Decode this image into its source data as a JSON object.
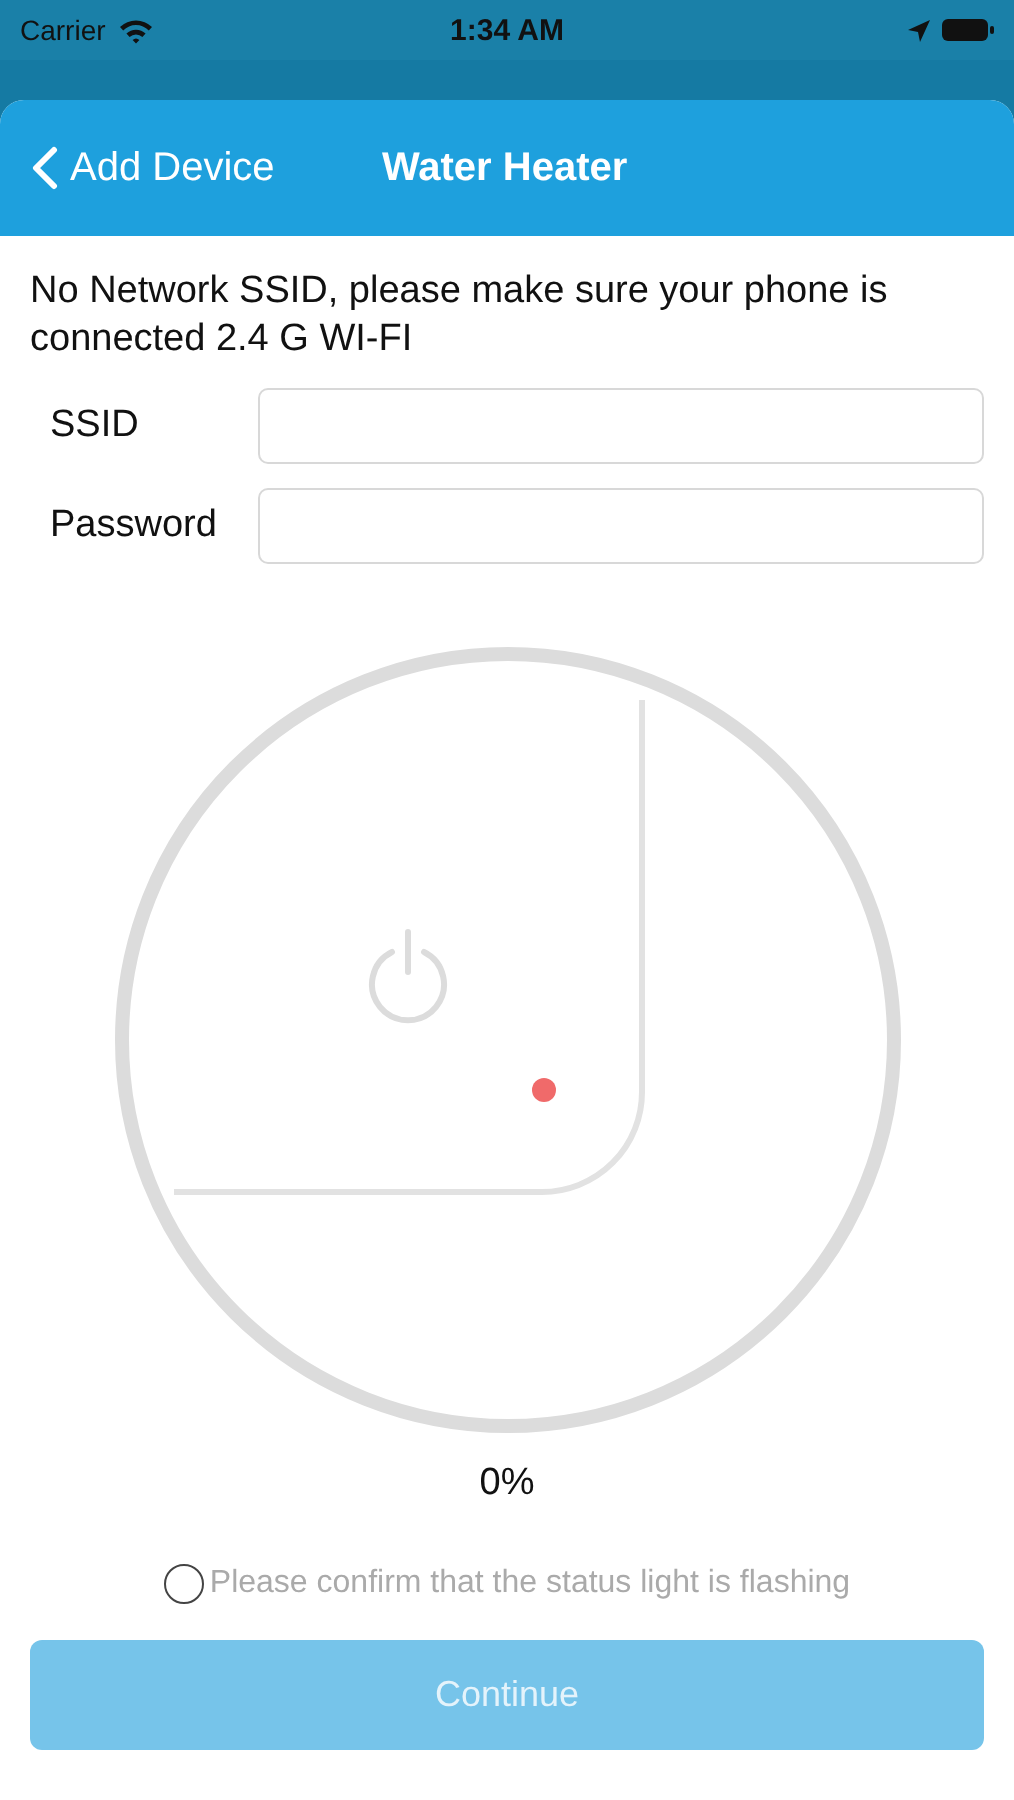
{
  "status_bar": {
    "carrier": "Carrier",
    "time": "1:34 AM"
  },
  "nav": {
    "back": "Add Device",
    "title": "Water Heater"
  },
  "message": "No Network SSID, please make sure your phone is connected 2.4 G WI-FI",
  "fields": [
    {
      "label": "SSID"
    },
    {
      "label": "Password"
    }
  ],
  "progress": {
    "reading": "0%"
  },
  "confirm": {
    "label": "Please confirm that the status light is flashing",
    "checked": false
  },
  "continue_button": {
    "label": "Continue",
    "disabled": true
  }
}
